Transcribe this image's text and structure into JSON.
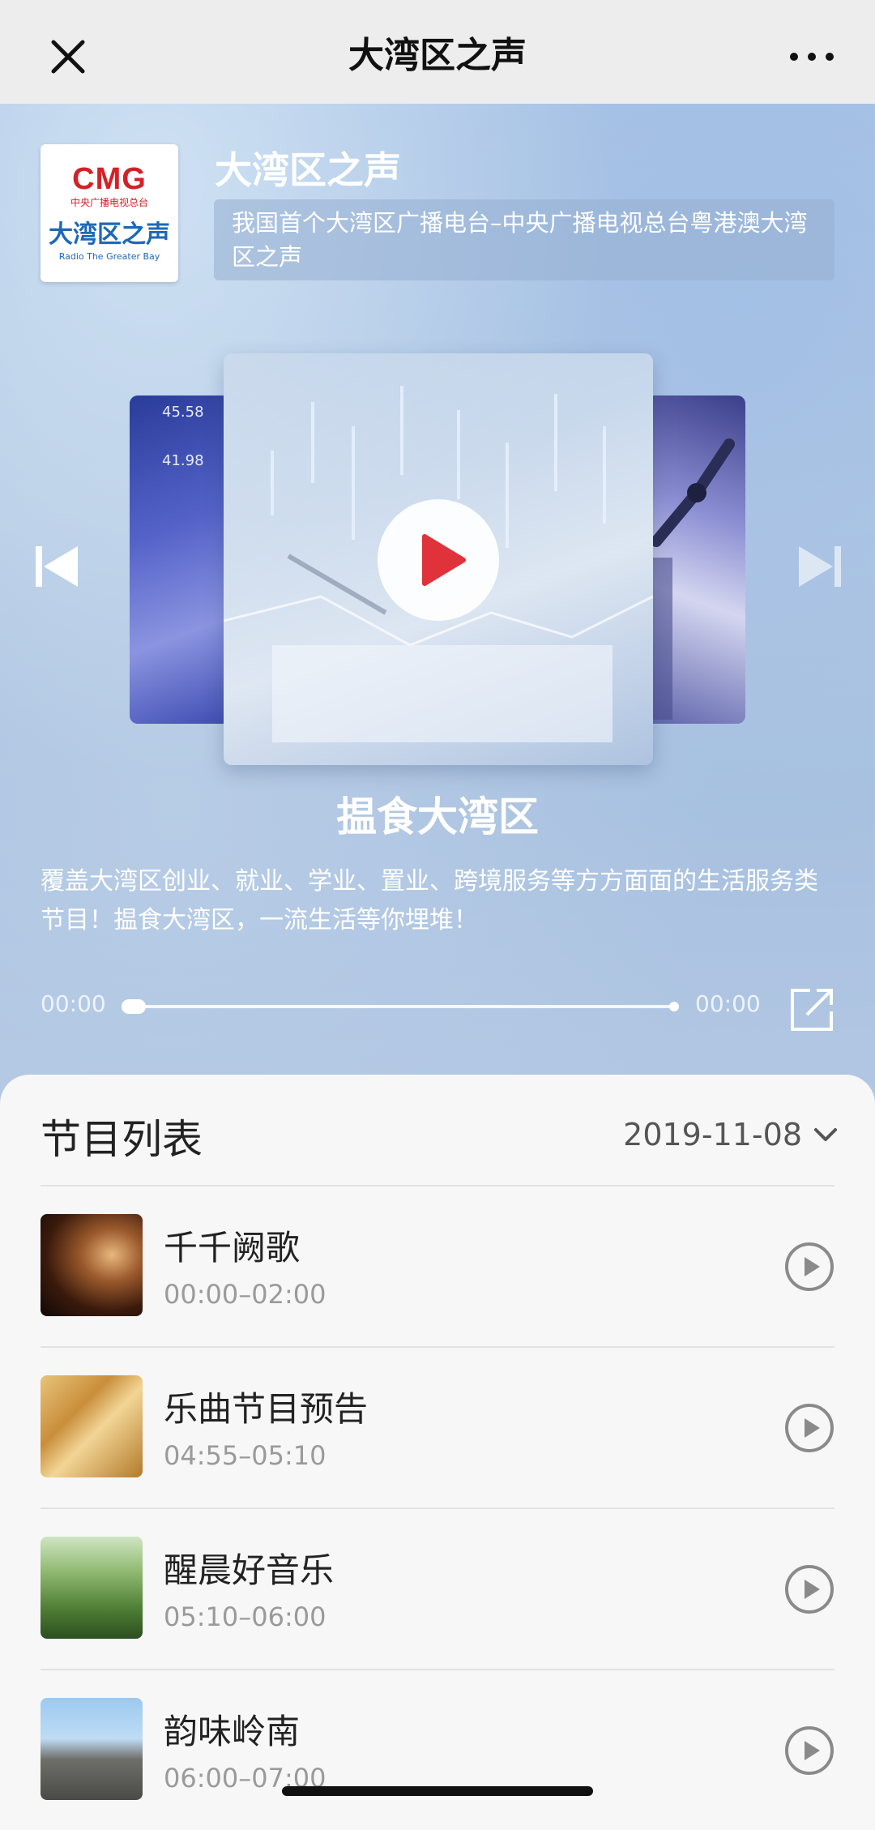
{
  "navbar": {
    "title": "大湾区之声",
    "close_icon": "close-icon",
    "more_icon": "more-horizontal-icon"
  },
  "station": {
    "logo_text_cmg": "CMG",
    "logo_text_sub": "中央广播电视总台",
    "logo_text_cn": "大湾区之声",
    "logo_text_en": "Radio The Greater Bay",
    "name": "大湾区之声",
    "description": "我国首个大湾区广播电台–中央广播电视总台粤港澳大湾区之声"
  },
  "carousel": {
    "left_card_numbers": [
      "45.58",
      "41.98"
    ]
  },
  "player": {
    "program_title": "揾食大湾区",
    "program_description": "覆盖大湾区创业、就业、学业、置业、跨境服务等方方面面的生活服务类节目！揾食大湾区，一流生活等你埋堆！",
    "time_current": "00:00",
    "time_total": "00:00",
    "progress": 0
  },
  "schedule": {
    "title": "节目列表",
    "date": "2019-11-08",
    "items": [
      {
        "title": "千千阙歌",
        "time": "00:00–02:00"
      },
      {
        "title": "乐曲节目预告",
        "time": "04:55–05:10"
      },
      {
        "title": "醒晨好音乐",
        "time": "05:10–06:00"
      },
      {
        "title": "韵味岭南",
        "time": "06:00–07:00"
      }
    ]
  },
  "colors": {
    "accent_red": "#e0323a",
    "navbar_bg": "#ededed",
    "hero_bg": "#a9c3e3"
  }
}
